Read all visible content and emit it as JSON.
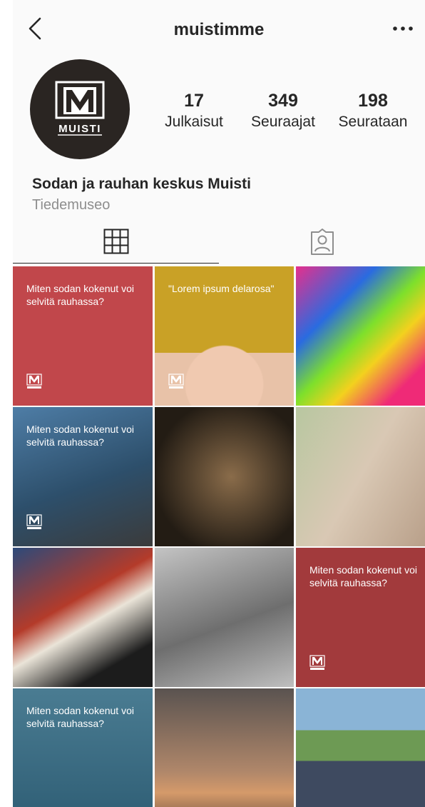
{
  "header": {
    "title": "muistimme",
    "back_icon": "chevron-left-icon",
    "more_icon": "more-horizontal-icon"
  },
  "profile": {
    "avatar_logo_text": "MUISTI",
    "stats": [
      {
        "value": "17",
        "label": "Julkaisut"
      },
      {
        "value": "349",
        "label": "Seuraajat"
      },
      {
        "value": "198",
        "label": "Seurataan"
      }
    ],
    "name": "Sodan ja rauhan keskus Muisti",
    "category": "Tiedemuseo"
  },
  "tabs": [
    {
      "icon": "grid-icon",
      "active": true
    },
    {
      "icon": "tagged-person-icon",
      "active": false
    }
  ],
  "posts": [
    {
      "style": "red",
      "caption": "Miten sodan kokenut voi selvitä rauhassa?",
      "logo": "MUISTI"
    },
    {
      "style": "hat",
      "caption": "\"Lorem ipsum delarosa\"",
      "logo": "MUISTI"
    },
    {
      "style": "neon",
      "caption": ""
    },
    {
      "style": "soldier",
      "caption": "Miten sodan kokenut voi selvitä rauhassa?",
      "logo": "MUISTI"
    },
    {
      "style": "museum",
      "caption": ""
    },
    {
      "style": "child",
      "caption": ""
    },
    {
      "style": "books",
      "caption": ""
    },
    {
      "style": "bw",
      "caption": ""
    },
    {
      "style": "redsoldier",
      "caption": "Miten sodan kokenut voi selvitä rauhassa?",
      "logo": "MUISTI"
    },
    {
      "style": "teal",
      "caption": "Miten sodan kokenut voi selvitä rauhassa?"
    },
    {
      "style": "sunset",
      "caption": ""
    },
    {
      "style": "group",
      "caption": ""
    }
  ],
  "colors": {
    "text": "#262626",
    "muted": "#8e8e8e",
    "brand_red": "#c1474b"
  }
}
